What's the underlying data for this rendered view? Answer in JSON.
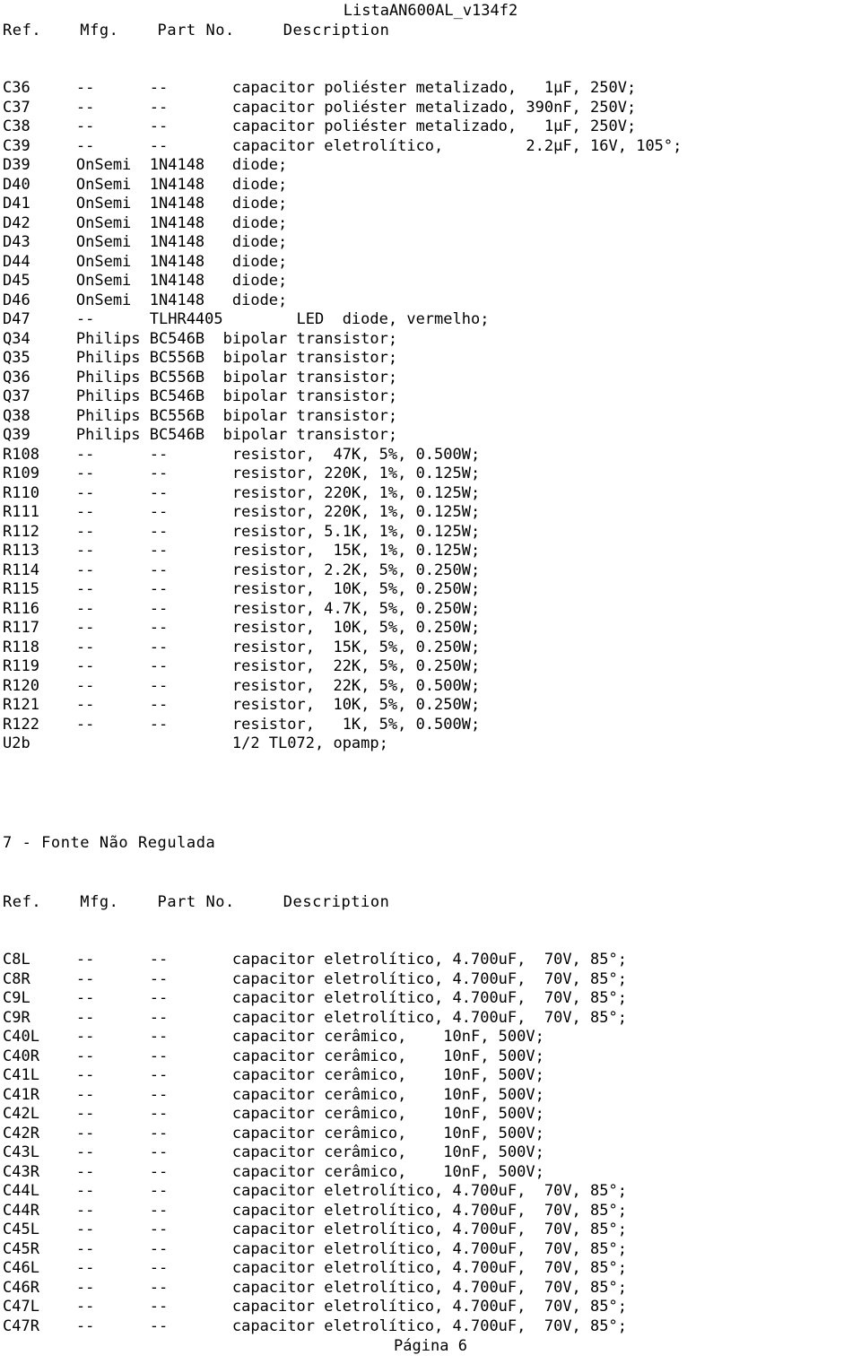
{
  "document": {
    "title": "ListaAN600AL_v134f2",
    "footer": "Página 6"
  },
  "columns": {
    "ref": "Ref.",
    "mfg": "Mfg.",
    "part_no": "Part No.",
    "description": "Description"
  },
  "header_line": "Ref.    Mfg.    Part No.     Description",
  "sections": [
    {
      "heading": null,
      "header_line": "Ref.    Mfg.    Part No.     Description",
      "rows": [
        {
          "ref": "C36",
          "mfg": "--",
          "part_no": "--",
          "description": "capacitor poliéster metalizado,   1µF, 250V;",
          "line": "C36     --      --       capacitor poliéster metalizado,   1µF, 250V;"
        },
        {
          "ref": "C37",
          "mfg": "--",
          "part_no": "--",
          "description": "capacitor poliéster metalizado, 390nF, 250V;",
          "line": "C37     --      --       capacitor poliéster metalizado, 390nF, 250V;"
        },
        {
          "ref": "C38",
          "mfg": "--",
          "part_no": "--",
          "description": "capacitor poliéster metalizado,   1µF, 250V;",
          "line": "C38     --      --       capacitor poliéster metalizado,   1µF, 250V;"
        },
        {
          "ref": "C39",
          "mfg": "--",
          "part_no": "--",
          "description": "capacitor eletrolítico,          2.2µF, 16V, 105°;",
          "line": "C39     --      --       capacitor eletrolítico,         2.2µF, 16V, 105°;"
        },
        {
          "ref": "D39",
          "mfg": "OnSemi",
          "part_no": "1N4148",
          "description": "diode;",
          "line": "D39     OnSemi  1N4148   diode;"
        },
        {
          "ref": "D40",
          "mfg": "OnSemi",
          "part_no": "1N4148",
          "description": "diode;",
          "line": "D40     OnSemi  1N4148   diode;"
        },
        {
          "ref": "D41",
          "mfg": "OnSemi",
          "part_no": "1N4148",
          "description": "diode;",
          "line": "D41     OnSemi  1N4148   diode;"
        },
        {
          "ref": "D42",
          "mfg": "OnSemi",
          "part_no": "1N4148",
          "description": "diode;",
          "line": "D42     OnSemi  1N4148   diode;"
        },
        {
          "ref": "D43",
          "mfg": "OnSemi",
          "part_no": "1N4148",
          "description": "diode;",
          "line": "D43     OnSemi  1N4148   diode;"
        },
        {
          "ref": "D44",
          "mfg": "OnSemi",
          "part_no": "1N4148",
          "description": "diode;",
          "line": "D44     OnSemi  1N4148   diode;"
        },
        {
          "ref": "D45",
          "mfg": "OnSemi",
          "part_no": "1N4148",
          "description": "diode;",
          "line": "D45     OnSemi  1N4148   diode;"
        },
        {
          "ref": "D46",
          "mfg": "OnSemi",
          "part_no": "1N4148",
          "description": "diode;",
          "line": "D46     OnSemi  1N4148   diode;"
        },
        {
          "ref": "D47",
          "mfg": "--",
          "part_no": "TLHR4405",
          "description": "LED  diode, vermelho;",
          "line": "D47     --      TLHR4405        LED  diode, vermelho;"
        },
        {
          "ref": "Q34",
          "mfg": "Philips",
          "part_no": "BC546B",
          "description": "bipolar transistor;",
          "line": "Q34     Philips BC546B  bipolar transistor;"
        },
        {
          "ref": "Q35",
          "mfg": "Philips",
          "part_no": "BC556B",
          "description": "bipolar transistor;",
          "line": "Q35     Philips BC556B  bipolar transistor;"
        },
        {
          "ref": "Q36",
          "mfg": "Philips",
          "part_no": "BC556B",
          "description": "bipolar transistor;",
          "line": "Q36     Philips BC556B  bipolar transistor;"
        },
        {
          "ref": "Q37",
          "mfg": "Philips",
          "part_no": "BC546B",
          "description": "bipolar transistor;",
          "line": "Q37     Philips BC546B  bipolar transistor;"
        },
        {
          "ref": "Q38",
          "mfg": "Philips",
          "part_no": "BC556B",
          "description": "bipolar transistor;",
          "line": "Q38     Philips BC556B  bipolar transistor;"
        },
        {
          "ref": "Q39",
          "mfg": "Philips",
          "part_no": "BC546B",
          "description": "bipolar transistor;",
          "line": "Q39     Philips BC546B  bipolar transistor;"
        },
        {
          "ref": "R108",
          "mfg": "--",
          "part_no": "--",
          "description": "resistor,  47K, 5%, 0.500W;",
          "line": "R108    --      --       resistor,  47K, 5%, 0.500W;"
        },
        {
          "ref": "R109",
          "mfg": "--",
          "part_no": "--",
          "description": "resistor, 220K, 1%, 0.125W;",
          "line": "R109    --      --       resistor, 220K, 1%, 0.125W;"
        },
        {
          "ref": "R110",
          "mfg": "--",
          "part_no": "--",
          "description": "resistor, 220K, 1%, 0.125W;",
          "line": "R110    --      --       resistor, 220K, 1%, 0.125W;"
        },
        {
          "ref": "R111",
          "mfg": "--",
          "part_no": "--",
          "description": "resistor, 220K, 1%, 0.125W;",
          "line": "R111    --      --       resistor, 220K, 1%, 0.125W;"
        },
        {
          "ref": "R112",
          "mfg": "--",
          "part_no": "--",
          "description": "resistor, 5.1K, 1%, 0.125W;",
          "line": "R112    --      --       resistor, 5.1K, 1%, 0.125W;"
        },
        {
          "ref": "R113",
          "mfg": "--",
          "part_no": "--",
          "description": "resistor,  15K, 1%, 0.125W;",
          "line": "R113    --      --       resistor,  15K, 1%, 0.125W;"
        },
        {
          "ref": "R114",
          "mfg": "--",
          "part_no": "--",
          "description": "resistor, 2.2K, 5%, 0.250W;",
          "line": "R114    --      --       resistor, 2.2K, 5%, 0.250W;"
        },
        {
          "ref": "R115",
          "mfg": "--",
          "part_no": "--",
          "description": "resistor,  10K, 5%, 0.250W;",
          "line": "R115    --      --       resistor,  10K, 5%, 0.250W;"
        },
        {
          "ref": "R116",
          "mfg": "--",
          "part_no": "--",
          "description": "resistor, 4.7K, 5%, 0.250W;",
          "line": "R116    --      --       resistor, 4.7K, 5%, 0.250W;"
        },
        {
          "ref": "R117",
          "mfg": "--",
          "part_no": "--",
          "description": "resistor,  10K, 5%, 0.250W;",
          "line": "R117    --      --       resistor,  10K, 5%, 0.250W;"
        },
        {
          "ref": "R118",
          "mfg": "--",
          "part_no": "--",
          "description": "resistor,  15K, 5%, 0.250W;",
          "line": "R118    --      --       resistor,  15K, 5%, 0.250W;"
        },
        {
          "ref": "R119",
          "mfg": "--",
          "part_no": "--",
          "description": "resistor,  22K, 5%, 0.250W;",
          "line": "R119    --      --       resistor,  22K, 5%, 0.250W;"
        },
        {
          "ref": "R120",
          "mfg": "--",
          "part_no": "--",
          "description": "resistor,  22K, 5%, 0.500W;",
          "line": "R120    --      --       resistor,  22K, 5%, 0.500W;"
        },
        {
          "ref": "R121",
          "mfg": "--",
          "part_no": "--",
          "description": "resistor,  10K, 5%, 0.250W;",
          "line": "R121    --      --       resistor,  10K, 5%, 0.250W;"
        },
        {
          "ref": "R122",
          "mfg": "--",
          "part_no": "--",
          "description": "resistor,   1K, 5%, 0.500W;",
          "line": "R122    --      --       resistor,   1K, 5%, 0.500W;"
        },
        {
          "ref": "U2b",
          "mfg": "",
          "part_no": "",
          "description": "1/2 TL072, opamp;",
          "line": "U2b                      1/2 TL072, opamp;"
        }
      ]
    },
    {
      "heading": "7 - Fonte Não Regulada",
      "header_line": "Ref.    Mfg.    Part No.     Description",
      "rows": [
        {
          "ref": "C8L",
          "mfg": "--",
          "part_no": "--",
          "description": "capacitor eletrolítico, 4.700uF,  70V, 85°;",
          "line": "C8L     --      --       capacitor eletrolítico, 4.700uF,  70V, 85°;"
        },
        {
          "ref": "C8R",
          "mfg": "--",
          "part_no": "--",
          "description": "capacitor eletrolítico, 4.700uF,  70V, 85°;",
          "line": "C8R     --      --       capacitor eletrolítico, 4.700uF,  70V, 85°;"
        },
        {
          "ref": "C9L",
          "mfg": "--",
          "part_no": "--",
          "description": "capacitor eletrolítico, 4.700uF,  70V, 85°;",
          "line": "C9L     --      --       capacitor eletrolítico, 4.700uF,  70V, 85°;"
        },
        {
          "ref": "C9R",
          "mfg": "--",
          "part_no": "--",
          "description": "capacitor eletrolítico, 4.700uF,  70V, 85°;",
          "line": "C9R     --      --       capacitor eletrolítico, 4.700uF,  70V, 85°;"
        },
        {
          "ref": "C40L",
          "mfg": "--",
          "part_no": "--",
          "description": "capacitor cerâmico,   10nF, 500V;",
          "line": "C40L    --      --       capacitor cerâmico,    10nF, 500V;"
        },
        {
          "ref": "C40R",
          "mfg": "--",
          "part_no": "--",
          "description": "capacitor cerâmico,   10nF, 500V;",
          "line": "C40R    --      --       capacitor cerâmico,    10nF, 500V;"
        },
        {
          "ref": "C41L",
          "mfg": "--",
          "part_no": "--",
          "description": "capacitor cerâmico,   10nF, 500V;",
          "line": "C41L    --      --       capacitor cerâmico,    10nF, 500V;"
        },
        {
          "ref": "C41R",
          "mfg": "--",
          "part_no": "--",
          "description": "capacitor cerâmico,   10nF, 500V;",
          "line": "C41R    --      --       capacitor cerâmico,    10nF, 500V;"
        },
        {
          "ref": "C42L",
          "mfg": "--",
          "part_no": "--",
          "description": "capacitor cerâmico,   10nF, 500V;",
          "line": "C42L    --      --       capacitor cerâmico,    10nF, 500V;"
        },
        {
          "ref": "C42R",
          "mfg": "--",
          "part_no": "--",
          "description": "capacitor cerâmico,   10nF, 500V;",
          "line": "C42R    --      --       capacitor cerâmico,    10nF, 500V;"
        },
        {
          "ref": "C43L",
          "mfg": "--",
          "part_no": "--",
          "description": "capacitor cerâmico,   10nF, 500V;",
          "line": "C43L    --      --       capacitor cerâmico,    10nF, 500V;"
        },
        {
          "ref": "C43R",
          "mfg": "--",
          "part_no": "--",
          "description": "capacitor cerâmico,   10nF, 500V;",
          "line": "C43R    --      --       capacitor cerâmico,    10nF, 500V;"
        },
        {
          "ref": "C44L",
          "mfg": "--",
          "part_no": "--",
          "description": "capacitor eletrolítico, 4.700uF,  70V, 85°;",
          "line": "C44L    --      --       capacitor eletrolítico, 4.700uF,  70V, 85°;"
        },
        {
          "ref": "C44R",
          "mfg": "--",
          "part_no": "--",
          "description": "capacitor eletrolítico, 4.700uF,  70V, 85°;",
          "line": "C44R    --      --       capacitor eletrolítico, 4.700uF,  70V, 85°;"
        },
        {
          "ref": "C45L",
          "mfg": "--",
          "part_no": "--",
          "description": "capacitor eletrolítico, 4.700uF,  70V, 85°;",
          "line": "C45L    --      --       capacitor eletrolítico, 4.700uF,  70V, 85°;"
        },
        {
          "ref": "C45R",
          "mfg": "--",
          "part_no": "--",
          "description": "capacitor eletrolítico, 4.700uF,  70V, 85°;",
          "line": "C45R    --      --       capacitor eletrolítico, 4.700uF,  70V, 85°;"
        },
        {
          "ref": "C46L",
          "mfg": "--",
          "part_no": "--",
          "description": "capacitor eletrolítico, 4.700uF,  70V, 85°;",
          "line": "C46L    --      --       capacitor eletrolítico, 4.700uF,  70V, 85°;"
        },
        {
          "ref": "C46R",
          "mfg": "--",
          "part_no": "--",
          "description": "capacitor eletrolítico, 4.700uF,  70V, 85°;",
          "line": "C46R    --      --       capacitor eletrolítico, 4.700uF,  70V, 85°;"
        },
        {
          "ref": "C47L",
          "mfg": "--",
          "part_no": "--",
          "description": "capacitor eletrolítico, 4.700uF,  70V, 85°;",
          "line": "C47L    --      --       capacitor eletrolítico, 4.700uF,  70V, 85°;"
        },
        {
          "ref": "C47R",
          "mfg": "--",
          "part_no": "--",
          "description": "capacitor eletrolítico, 4.700uF,  70V, 85°;",
          "line": "C47R    --      --       capacitor eletrolítico, 4.700uF,  70V, 85°;"
        }
      ]
    }
  ]
}
